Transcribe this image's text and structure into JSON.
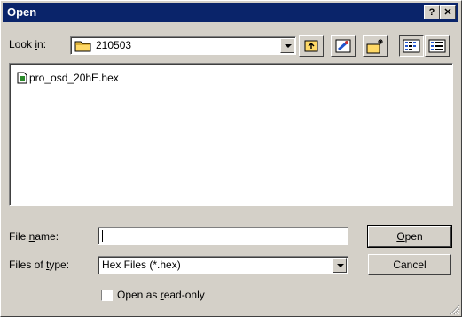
{
  "window": {
    "title": "Open",
    "help_label": "?",
    "close_label": "✕"
  },
  "look_in": {
    "label_prefix": "Look ",
    "label_accel": "i",
    "label_suffix": "n:",
    "value": "210503"
  },
  "toolbar": {
    "buttons": [
      {
        "name": "up-one-level-icon"
      },
      {
        "name": "desktop-icon"
      },
      {
        "name": "new-folder-icon"
      },
      {
        "name": "list-view-icon",
        "pressed": true
      },
      {
        "name": "details-view-icon"
      }
    ]
  },
  "file_list": {
    "items": [
      {
        "name": "pro_osd_20hE.hex"
      }
    ]
  },
  "file_name": {
    "label_prefix": "File ",
    "label_accel": "n",
    "label_suffix": "ame:",
    "value": ""
  },
  "files_of_type": {
    "label_prefix": "Files of ",
    "label_accel": "t",
    "label_suffix": "ype:",
    "value": "Hex Files (*.hex)"
  },
  "buttons": {
    "open_accel": "O",
    "open_rest": "pen",
    "cancel_label": "Cancel"
  },
  "read_only": {
    "label_prefix": "Open as ",
    "label_accel": "r",
    "label_suffix": "ead-only",
    "checked": false
  }
}
